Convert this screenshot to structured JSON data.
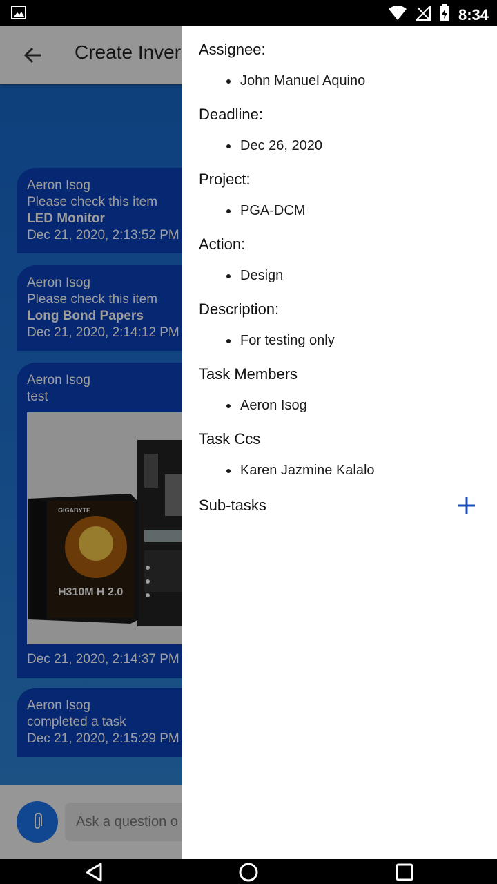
{
  "status_bar": {
    "time": "8:34",
    "icons": [
      "image-icon",
      "wifi-icon",
      "no-signal-icon",
      "battery-charging-icon"
    ]
  },
  "app": {
    "title": "Create Inver",
    "input_placeholder": "Ask a question o",
    "messages": [
      {
        "sender": "Aeron Isog",
        "text": "Please check this item",
        "item": "LED Monitor",
        "time": "Dec 21, 2020, 2:13:52 PM"
      },
      {
        "sender": "Aeron Isog",
        "text": "Please check this item",
        "item": "Long Bond Papers",
        "time": "Dec 21, 2020, 2:14:12 PM"
      },
      {
        "sender": "Aeron Isog",
        "text": "test",
        "photo_brand": "GIGABYTE",
        "photo_model": "H310M H 2.0",
        "time": "Dec 21, 2020, 2:14:37 PM"
      },
      {
        "sender": "Aeron Isog",
        "text": "completed a task",
        "time": "Dec 21, 2020, 2:15:29 PM"
      }
    ]
  },
  "drawer": {
    "fields": [
      {
        "label": "Assignee:",
        "values": [
          "John Manuel Aquino"
        ]
      },
      {
        "label": "Deadline:",
        "values": [
          "Dec 26, 2020"
        ]
      },
      {
        "label": "Project:",
        "values": [
          "PGA-DCM"
        ]
      },
      {
        "label": "Action:",
        "values": [
          "Design"
        ]
      },
      {
        "label": "Description:",
        "values": [
          "For testing only"
        ]
      },
      {
        "label": "Task Members",
        "values": [
          "Aeron Isog"
        ]
      },
      {
        "label": "Task Ccs",
        "values": [
          "Karen Jazmine Kalalo"
        ]
      }
    ],
    "subtasks_label": "Sub-tasks",
    "accent": "#1a4fc4"
  }
}
